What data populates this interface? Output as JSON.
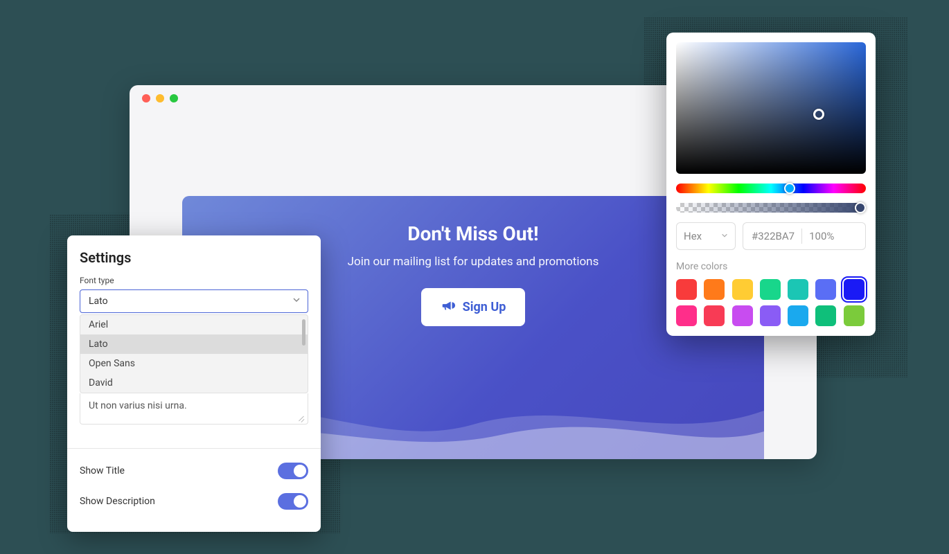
{
  "hero": {
    "title": "Don't Miss Out!",
    "subtitle": "Join our mailing list for updates and promotions",
    "cta_label": "Sign Up"
  },
  "settings": {
    "title": "Settings",
    "font_label": "Font type",
    "font_selected": "Lato",
    "font_options": [
      "Ariel",
      "Lato",
      "Open Sans",
      "David"
    ],
    "textarea_value": "Ut non varius nisi urna.",
    "show_title_label": "Show Title",
    "show_title_on": true,
    "show_description_label": "Show Description",
    "show_description_on": true
  },
  "picker": {
    "mode": "Hex",
    "hex": "#322BA7",
    "opacity": "100%",
    "more_colors_label": "More colors",
    "swatches_row1": [
      "#f83b3b",
      "#ff7a1a",
      "#ffcc33",
      "#18d68b",
      "#1bc6b4",
      "#5a6ef5",
      "#1a1af5"
    ],
    "swatches_row2": [
      "#ff2e8a",
      "#f83b55",
      "#c84cf0",
      "#8a5cf5",
      "#1aa9ee",
      "#0fbf7a",
      "#7bcb3b"
    ],
    "selected_swatch_index": 6
  }
}
